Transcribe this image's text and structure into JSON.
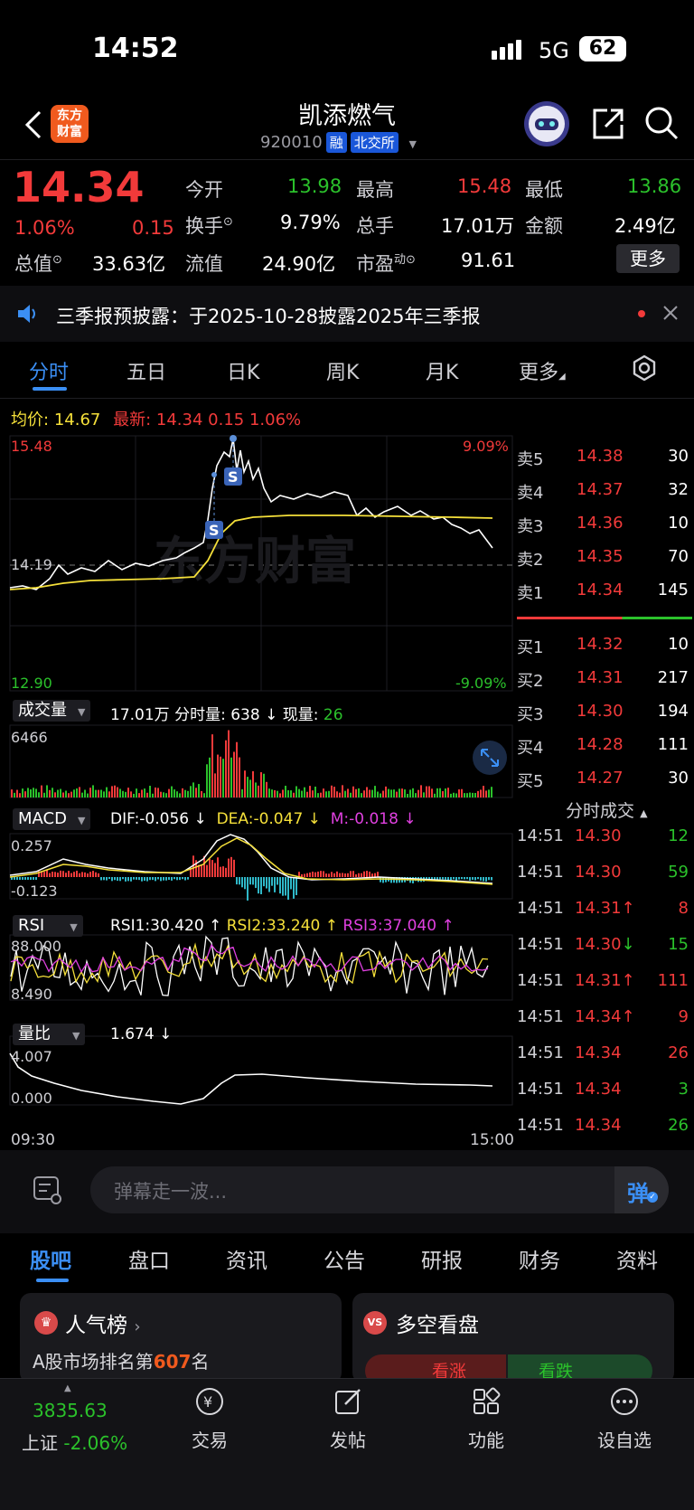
{
  "status_bar": {
    "time": "14:52",
    "network": "5G",
    "battery": "62"
  },
  "header": {
    "title": "凯添燃气",
    "code": "920010",
    "tag_margin": "融",
    "tag_exchange": "北交所",
    "logo_line1": "东方",
    "logo_line2": "财富"
  },
  "quote": {
    "price": "14.34",
    "change_pct": "1.06%",
    "change": "0.15",
    "open_label": "今开",
    "open": "13.98",
    "high_label": "最高",
    "high": "15.48",
    "low_label": "最低",
    "low": "13.86",
    "turnover_label": "换手",
    "turnover": "9.79%",
    "volume_label": "总手",
    "volume": "17.01万",
    "amount_label": "金额",
    "amount": "2.49亿",
    "mcap_label": "总值",
    "mcap": "33.63亿",
    "float_label": "流值",
    "float": "24.90亿",
    "pe_label": "市盈",
    "pe_sup": "动",
    "pe": "91.61",
    "more_button": "更多"
  },
  "notice": {
    "text": "三季报预披露：于2025-10-28披露2025年三季报"
  },
  "tabs": [
    "分时",
    "五日",
    "日K",
    "周K",
    "月K",
    "更多"
  ],
  "chart_header": {
    "avg_label": "均价:",
    "avg_value": "14.67",
    "latest_label": "最新:",
    "latest_value": "14.34",
    "latest_change": "0.15",
    "latest_pct": "1.06%"
  },
  "price_chart": {
    "top_price": "15.48",
    "ref_price": "14.19",
    "bottom_price": "12.90",
    "top_pct": "9.09%",
    "bottom_pct": "-9.09%",
    "watermark": "东方财富",
    "marker": "S"
  },
  "volume_panel": {
    "button": "成交量",
    "total": "17.01万",
    "tick_label": "分时量:",
    "tick_value": "638 ↓",
    "current_label": "现量:",
    "current_value": "26",
    "max_label": "6466"
  },
  "macd_panel": {
    "button": "MACD",
    "dif": "DIF:-0.056 ↓",
    "dea": "DEA:-0.047 ↓",
    "m": "M:-0.018 ↓",
    "top": "0.257",
    "bottom": "-0.123"
  },
  "rsi_panel": {
    "button": "RSI",
    "rsi1": "RSI1:30.420 ↑",
    "rsi2": "RSI2:33.240 ↑",
    "rsi3": "RSI3:37.040 ↑",
    "top": "88.000",
    "bottom": "8.490"
  },
  "ratio_panel": {
    "button": "量比",
    "value": "1.674 ↓",
    "top": "4.007",
    "bottom": "0.000",
    "start_time": "09:30",
    "end_time": "15:00"
  },
  "order_book": {
    "asks": [
      {
        "label": "卖5",
        "price": "14.38",
        "vol": "30"
      },
      {
        "label": "卖4",
        "price": "14.37",
        "vol": "32"
      },
      {
        "label": "卖3",
        "price": "14.36",
        "vol": "10"
      },
      {
        "label": "卖2",
        "price": "14.35",
        "vol": "70"
      },
      {
        "label": "卖1",
        "price": "14.34",
        "vol": "145"
      }
    ],
    "bids": [
      {
        "label": "买1",
        "price": "14.32",
        "vol": "10"
      },
      {
        "label": "买2",
        "price": "14.31",
        "vol": "217"
      },
      {
        "label": "买3",
        "price": "14.30",
        "vol": "194"
      },
      {
        "label": "买4",
        "price": "14.28",
        "vol": "111"
      },
      {
        "label": "买5",
        "price": "14.27",
        "vol": "30"
      }
    ]
  },
  "trades": {
    "header": "分时成交",
    "rows": [
      {
        "time": "14:51",
        "price": "14.30",
        "arrow": "",
        "vol": "12",
        "dir": "sell"
      },
      {
        "time": "14:51",
        "price": "14.30",
        "arrow": "",
        "vol": "59",
        "dir": "sell"
      },
      {
        "time": "14:51",
        "price": "14.31",
        "arrow": "↑",
        "vol": "8",
        "dir": "buy"
      },
      {
        "time": "14:51",
        "price": "14.30",
        "arrow": "↓",
        "vol": "15",
        "dir": "sell"
      },
      {
        "time": "14:51",
        "price": "14.31",
        "arrow": "↑",
        "vol": "111",
        "dir": "buy"
      },
      {
        "time": "14:51",
        "price": "14.34",
        "arrow": "↑",
        "vol": "9",
        "dir": "buy"
      },
      {
        "time": "14:51",
        "price": "14.34",
        "arrow": "",
        "vol": "26",
        "dir": "buy"
      },
      {
        "time": "14:51",
        "price": "14.34",
        "arrow": "",
        "vol": "3",
        "dir": "sell"
      },
      {
        "time": "14:51",
        "price": "14.34",
        "arrow": "",
        "vol": "26",
        "dir": "sell"
      }
    ]
  },
  "comment": {
    "placeholder": "弹幕走一波...",
    "danmu_button": "弹"
  },
  "bottom_tabs": [
    "股吧",
    "盘口",
    "资讯",
    "公告",
    "研报",
    "财务",
    "资料"
  ],
  "cards": {
    "popularity": {
      "title": "人气榜",
      "prefix": "A股市场排名第",
      "rank": "607",
      "suffix": "名"
    },
    "sentiment": {
      "title": "多空看盘",
      "up": "看涨",
      "down": "看跌"
    }
  },
  "nav": {
    "index_value": "3835.63",
    "index_name": "上证",
    "index_pct": "-2.06%",
    "trade": "交易",
    "post": "发帖",
    "function": "功能",
    "watchlist": "设自选"
  },
  "colors": {
    "up": "#f23a3a",
    "down": "#2bc12b",
    "avg_line": "#f5e03a",
    "accent": "#3b8ff5"
  }
}
